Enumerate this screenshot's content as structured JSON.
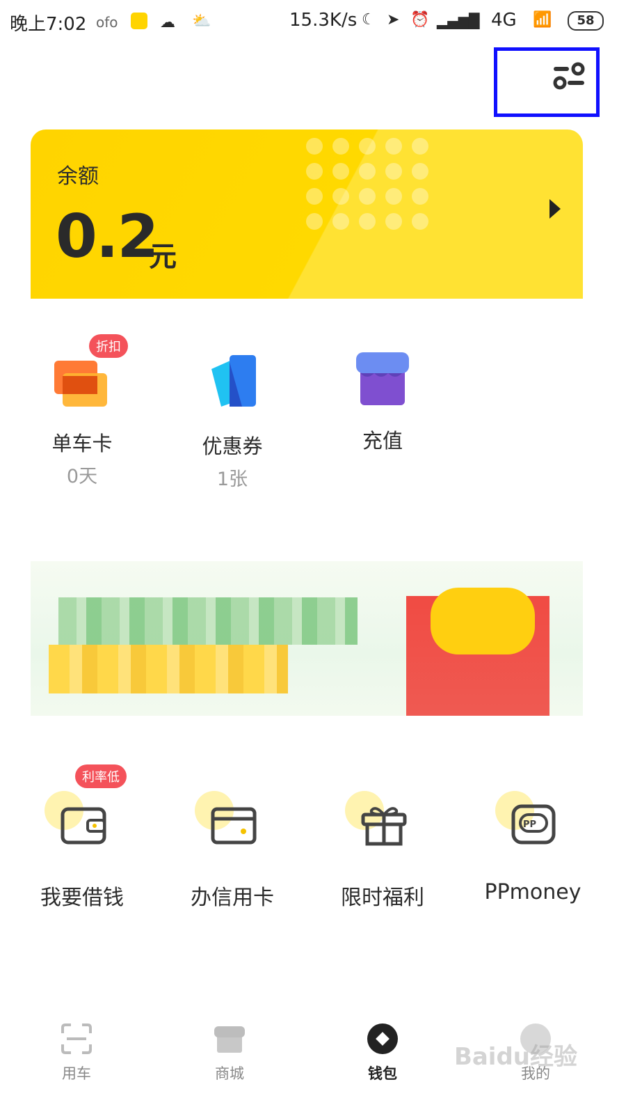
{
  "status_bar": {
    "time": "晚上7:02",
    "carrier_app": "ofo",
    "net_speed": "15.3K/s",
    "network": "4G",
    "battery": "58"
  },
  "header": {
    "settings_icon": "settings-toggle-icon"
  },
  "balance_card": {
    "label": "余额",
    "amount": "0.2",
    "unit": "元",
    "color": "#ffd400"
  },
  "quick_items": [
    {
      "label": "单车卡",
      "sub": "0天",
      "badge": "折扣",
      "icon": "bike-card-icon"
    },
    {
      "label": "优惠券",
      "sub": "1张",
      "badge": "",
      "icon": "coupon-icon"
    },
    {
      "label": "充值",
      "sub": "",
      "badge": "",
      "icon": "store-icon"
    }
  ],
  "services": [
    {
      "label": "我要借钱",
      "badge": "利率低",
      "icon": "wallet-icon"
    },
    {
      "label": "办信用卡",
      "badge": "",
      "icon": "credit-card-icon"
    },
    {
      "label": "限时福利",
      "badge": "",
      "icon": "gift-icon"
    },
    {
      "label": "PPmoney",
      "badge": "",
      "icon": "ppmoney-icon"
    }
  ],
  "bottom_nav": [
    {
      "label": "用车",
      "icon": "scan-icon",
      "active": false
    },
    {
      "label": "商城",
      "icon": "shop-icon",
      "active": false
    },
    {
      "label": "钱包",
      "icon": "wallet-nav-icon",
      "active": true
    },
    {
      "label": "我的",
      "icon": "profile-icon",
      "active": false
    }
  ],
  "watermark": "Baidu经验"
}
